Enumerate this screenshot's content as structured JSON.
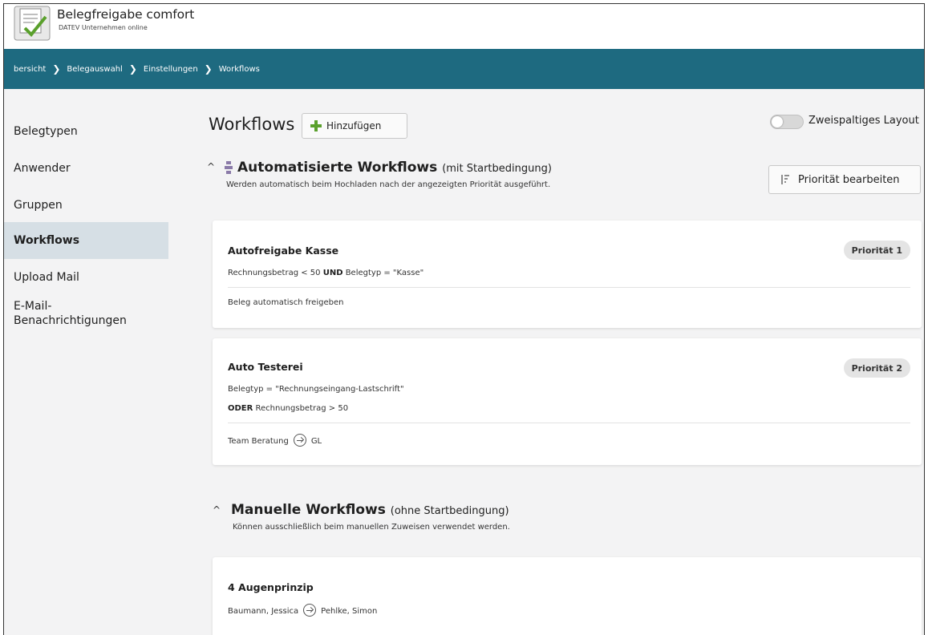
{
  "app": {
    "title": "Belegfreigabe comfort",
    "subtitle": "DATEV Unternehmen online"
  },
  "breadcrumb": [
    "bersicht",
    "Belegauswahl",
    "Einstellungen",
    "Workflows"
  ],
  "sidebar": {
    "items": [
      {
        "label": "Belegtypen",
        "active": false
      },
      {
        "label": "Anwender",
        "active": false
      },
      {
        "label": "Gruppen",
        "active": false
      },
      {
        "label": "Workflows",
        "active": true
      },
      {
        "label": "Upload Mail",
        "active": false
      },
      {
        "label": "E-Mail-",
        "active": false
      },
      {
        "label": "Benachrichtigungen",
        "active": false
      }
    ]
  },
  "main": {
    "title": "Workflows",
    "add_label": "Hinzufügen",
    "layout_toggle_label": "Zweispaltiges Layout",
    "layout_toggle_on": false,
    "priority_button_label": "Priorität bearbeiten"
  },
  "automated": {
    "title": "Automatisierte Workflows",
    "subtitle": "(mit Startbedingung)",
    "description": "Werden automatisch beim Hochladen nach der angezeigten Priorität ausgeführt.",
    "workflows": [
      {
        "name": "Autofreigabe Kasse",
        "priority": "Priorität 1",
        "condition_a": "Rechnungsbetrag < 50 ",
        "condition_op": "UND",
        "condition_b": " Belegtyp = \"Kasse\"",
        "action": "Beleg automatisch freigeben"
      },
      {
        "name": "Auto Testerei",
        "priority": "Priorität 2",
        "condition_line1": "Belegtyp = \"Rechnungseingang-Lastschrift\"",
        "condition_op": "ODER",
        "condition_line2": " Rechnungsbetrag > 50",
        "route_from": "Team Beratung",
        "route_to": "GL"
      }
    ]
  },
  "manual": {
    "title": "Manuelle Workflows",
    "subtitle": "(ohne Startbedingung)",
    "description": "Können ausschließlich beim manuellen Zuweisen verwendet werden.",
    "workflows": [
      {
        "name": "4 Augenprinzip",
        "route_from": "Baumann, Jessica",
        "route_to": "Pehlke, Simon"
      }
    ]
  },
  "colors": {
    "breadcrumb_bg": "#1e6a80",
    "page_bg": "#f3f3f4",
    "active_nav_bg": "#d6dfe5",
    "accent_plus": "#5aa02c"
  }
}
